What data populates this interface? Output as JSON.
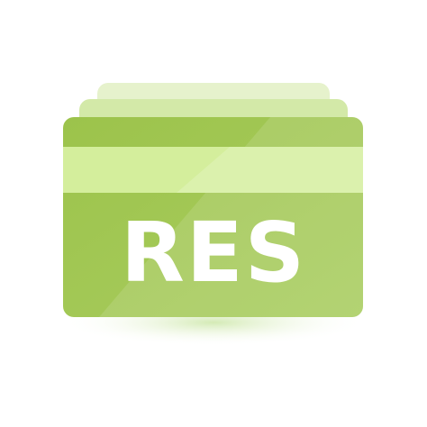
{
  "icon": {
    "label": "RES",
    "colors": {
      "card_front": "#9fc54f",
      "card_front_light": "#b3d46f",
      "stripe": "#d4ee9c",
      "card_back_1": "#d3e9a8",
      "card_back_2": "#e6f2cc",
      "text": "#ffffff",
      "shadow": "#c6e3a0"
    }
  }
}
